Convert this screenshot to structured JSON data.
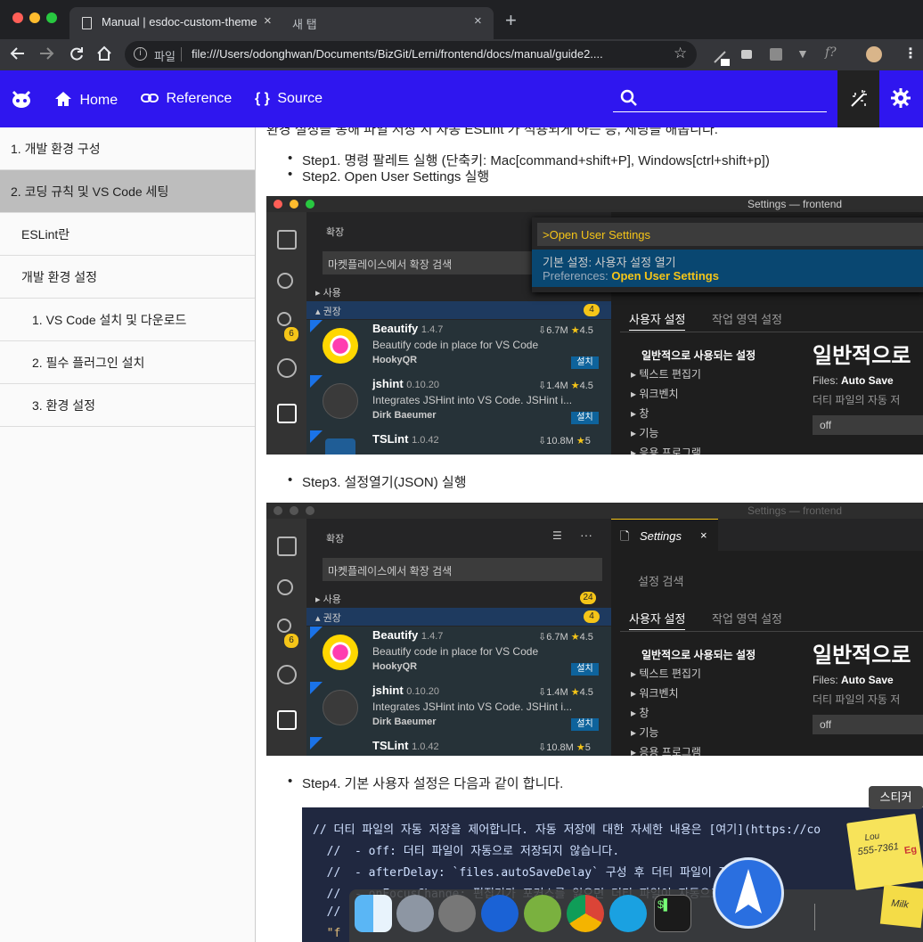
{
  "browser": {
    "tab_active_title": "Manual | esdoc-custom-theme",
    "tab_close": "×",
    "tab2_title": "새 탭",
    "new_tab": "+",
    "omnibox_label": "파일",
    "url": "file:///Users/odonghwan/Documents/BizGit/Lerni/frontend/docs/manual/guide2....",
    "ext_f": "f?"
  },
  "header": {
    "home": "Home",
    "reference": "Reference",
    "source": "Source",
    "search_placeholder": ""
  },
  "sidebar": {
    "items": [
      {
        "label": "1. 개발 환경 구성"
      },
      {
        "label": "2. 코딩 규칙 및 VS Code 세팅"
      },
      {
        "label": "ESLint란"
      },
      {
        "label": "개발 환경 설정"
      },
      {
        "label": "1. VS Code 설치 및 다운로드"
      },
      {
        "label": "2. 필수 플러그인 설치"
      },
      {
        "label": "3. 환경 설정"
      }
    ]
  },
  "content": {
    "intro": "환경 설정을 통해 파일 저장 시 자동 ESLint 가 적용되게 하는 등, 세팅을 해봅니다.",
    "step1": "Step1. 명령 팔레트 실행 (단축키: Mac[command+shift+P], Windows[ctrl+shift+p])",
    "step2": "Step2. Open User Settings 실행",
    "step3": "Step3. 설정열기(JSON) 실행",
    "step4": "Step4. 기본 사용자 설정은 다음과 같이 합니다."
  },
  "vscode1": {
    "title": "Settings — frontend",
    "panel_title": "확장",
    "search": "마켓플레이스에서 확장 검색",
    "group_used": "사용",
    "group_recommended": "권장",
    "recommended_count": "4",
    "scm_badge": "6",
    "palette_input": ">Open User Settings",
    "palette_line1": "기본 설정: 사용자 설정 열기",
    "palette_line2_prefix": "Preferences: ",
    "palette_line2_bold": "Open User Settings",
    "tab_user": "사용자 설정",
    "tab_workspace": "작업 영역 설정",
    "common": "일반적으로 사용되는 설정",
    "tree": [
      "텍스트 편집기",
      "워크벤치",
      "창",
      "기능",
      "응용 프로그램"
    ],
    "big_title": "일반적으로",
    "files_label": "Files: ",
    "files_value": "Auto Save",
    "files_desc": "더티 파일의 자동 저",
    "select_value": "off",
    "extensions": [
      {
        "name": "Beautify",
        "version": "1.4.7",
        "downloads": "6.7M",
        "rating": "4.5",
        "desc": "Beautify code in place for VS Code",
        "author": "HookyQR",
        "install": "설치"
      },
      {
        "name": "jshint",
        "version": "0.10.20",
        "downloads": "1.4M",
        "rating": "4.5",
        "desc": "Integrates JSHint into VS Code. JSHint i...",
        "author": "Dirk Baeumer",
        "install": "설치"
      },
      {
        "name": "TSLint",
        "version": "1.0.42",
        "downloads": "10.8M",
        "rating": "5",
        "desc": "",
        "author": "",
        "install": ""
      }
    ]
  },
  "vscode2": {
    "title": "Settings — frontend",
    "panel_title": "확장",
    "search": "마켓플레이스에서 확장 검색",
    "group_used": "사용",
    "used_count": "24",
    "group_recommended": "권장",
    "recommended_count": "4",
    "scm_badge": "6",
    "tab_label": "Settings",
    "settings_search": "설정 검색",
    "tab_user": "사용자 설정",
    "tab_workspace": "작업 영역 설정",
    "common": "일반적으로 사용되는 설정",
    "tree": [
      "텍스트 편집기",
      "워크벤치",
      "창",
      "기능",
      "응용 프로그램"
    ],
    "big_title": "일반적으로",
    "files_label": "Files: ",
    "files_value": "Auto Save",
    "files_desc": "더티 파일의 자동 저",
    "select_value": "off"
  },
  "code": {
    "lines": [
      "// 더티 파일의 자동 저장을 제어합니다. 자동 저장에 대한 자세한 내용은 [여기](https://co",
      "  //  - off: 더티 파일이 자동으로 저장되지 않습니다.",
      "  //  - afterDelay: `files.autoSaveDelay` 구성 후 더티 파일이 자동으로",
      "  //  - onFocusChange: 편집기가 포커스를 잃으면 더티 파일이 자동으로 저장됩니다",
      "  //",
      "  \"f"
    ]
  },
  "overlay": {
    "tooltip": "스티커",
    "note_line1": "Lou",
    "note_line2": "555-7361",
    "note_line3": "Eg",
    "note_milk": "Milk"
  },
  "colors": {
    "header_bg": "#2f16ef",
    "sidebar_active": "#bdbdbd",
    "code_bg": "#202840",
    "vs_accent": "#f5c518"
  }
}
